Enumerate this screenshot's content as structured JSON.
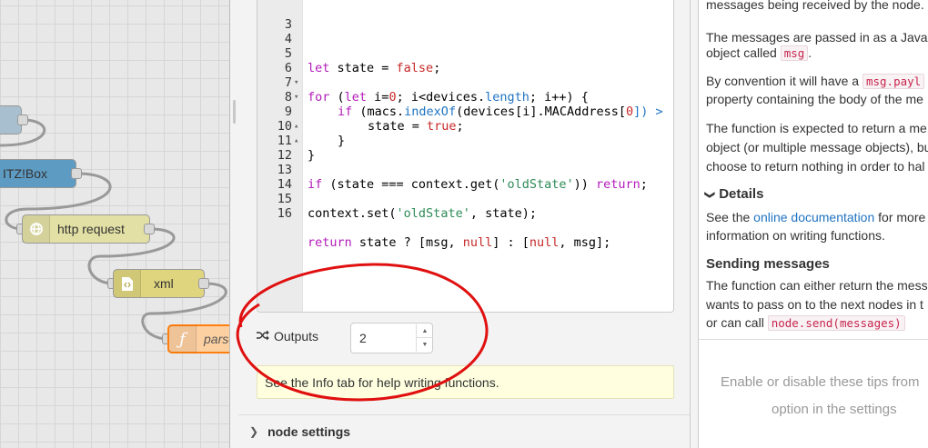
{
  "flow": {
    "nodes": [
      {
        "label": "",
        "icon": "none"
      },
      {
        "label": "ITZ!Box",
        "icon": "none"
      },
      {
        "label": "http request",
        "icon": "globe-icon"
      },
      {
        "label": "xml",
        "icon": "xml-icon"
      },
      {
        "label": "parse",
        "icon": "function-icon"
      }
    ]
  },
  "editor": {
    "lines": [
      {
        "n": "3",
        "fold": ""
      },
      {
        "n": "4",
        "fold": ""
      },
      {
        "n": "5",
        "fold": ""
      },
      {
        "n": "6",
        "fold": "▾"
      },
      {
        "n": "7",
        "fold": "▾"
      },
      {
        "n": "8",
        "fold": ""
      },
      {
        "n": "9",
        "fold": "▴"
      },
      {
        "n": "10",
        "fold": "▴"
      },
      {
        "n": "11",
        "fold": ""
      },
      {
        "n": "12",
        "fold": ""
      },
      {
        "n": "13",
        "fold": ""
      },
      {
        "n": "14",
        "fold": ""
      },
      {
        "n": "15",
        "fold": ""
      },
      {
        "n": "16",
        "fold": ""
      }
    ],
    "code": {
      "l4_kw": "let",
      "l4_a": " state = ",
      "l4_b": "false",
      "l4_c": ";",
      "l6_kw1": "for",
      "l6_a": " (",
      "l6_kw2": "let",
      "l6_b": " i=",
      "l6_n": "0",
      "l6_c": "; i<devices.",
      "l6_p": "length",
      "l6_d": "; i++) {",
      "l7_kw": "if",
      "l7_a": " (macs.",
      "l7_p": "indexOf",
      "l7_b": "(devices[i].MACAddress[",
      "l7_n": "0",
      "l7_c": "]) >",
      "l8_a": "state = ",
      "l8_b": "true",
      "l8_c": ";",
      "l9_a": "}",
      "l10_a": "}",
      "l12_kw": "if",
      "l12_a": " (state === context.get(",
      "l12_s": "'oldState'",
      "l12_b": ")) ",
      "l12_kw2": "return",
      "l12_c": ";",
      "l14_a": "context.set(",
      "l14_s": "'oldState'",
      "l14_b": ", state);",
      "l16_kw": "return",
      "l16_a": " state ? [msg, ",
      "l16_b": "null",
      "l16_c": "] : [",
      "l16_d": "null",
      "l16_e": ", msg];"
    }
  },
  "outputs": {
    "label": "Outputs",
    "value": "2"
  },
  "tip_text": "See the Info tab for help writing functions.",
  "node_settings_label": "node settings",
  "info": {
    "p1": "messages being received by the node.",
    "p2a": "The messages are passed in as a JavaS",
    "p2b_pre": "object called ",
    "p2b_code": "msg",
    "p2b_post": ".",
    "p3a_pre": "By convention it will have a ",
    "p3a_code": "msg.payl",
    "p3b": "property containing the body of the me",
    "p4a": "The function is expected to return a me",
    "p4b": "object (or multiple message objects), bu",
    "p4c": "choose to return nothing in order to hal",
    "details_heading": "Details",
    "p5a_pre": "See the ",
    "p5a_link": "online documentation",
    "p5a_post": " for more",
    "p5b": "information on writing functions.",
    "sending_heading": "Sending messages",
    "p6a": "The function can either return the mess",
    "p6b": "wants to pass on to the next nodes in t",
    "p6c_pre": "or can call ",
    "p6c_code": "node.send(messages)",
    "footer_line1": "Enable or disable these tips from",
    "footer_line2": "option in the settings"
  },
  "colors": {
    "node_blue": "#5e9bc3",
    "node_gray": "#a7bfcf",
    "node_olive": "#e2e0a4",
    "node_xml": "#dfd57f",
    "node_function": "#fdd0a2",
    "annotation": "#e01010"
  }
}
